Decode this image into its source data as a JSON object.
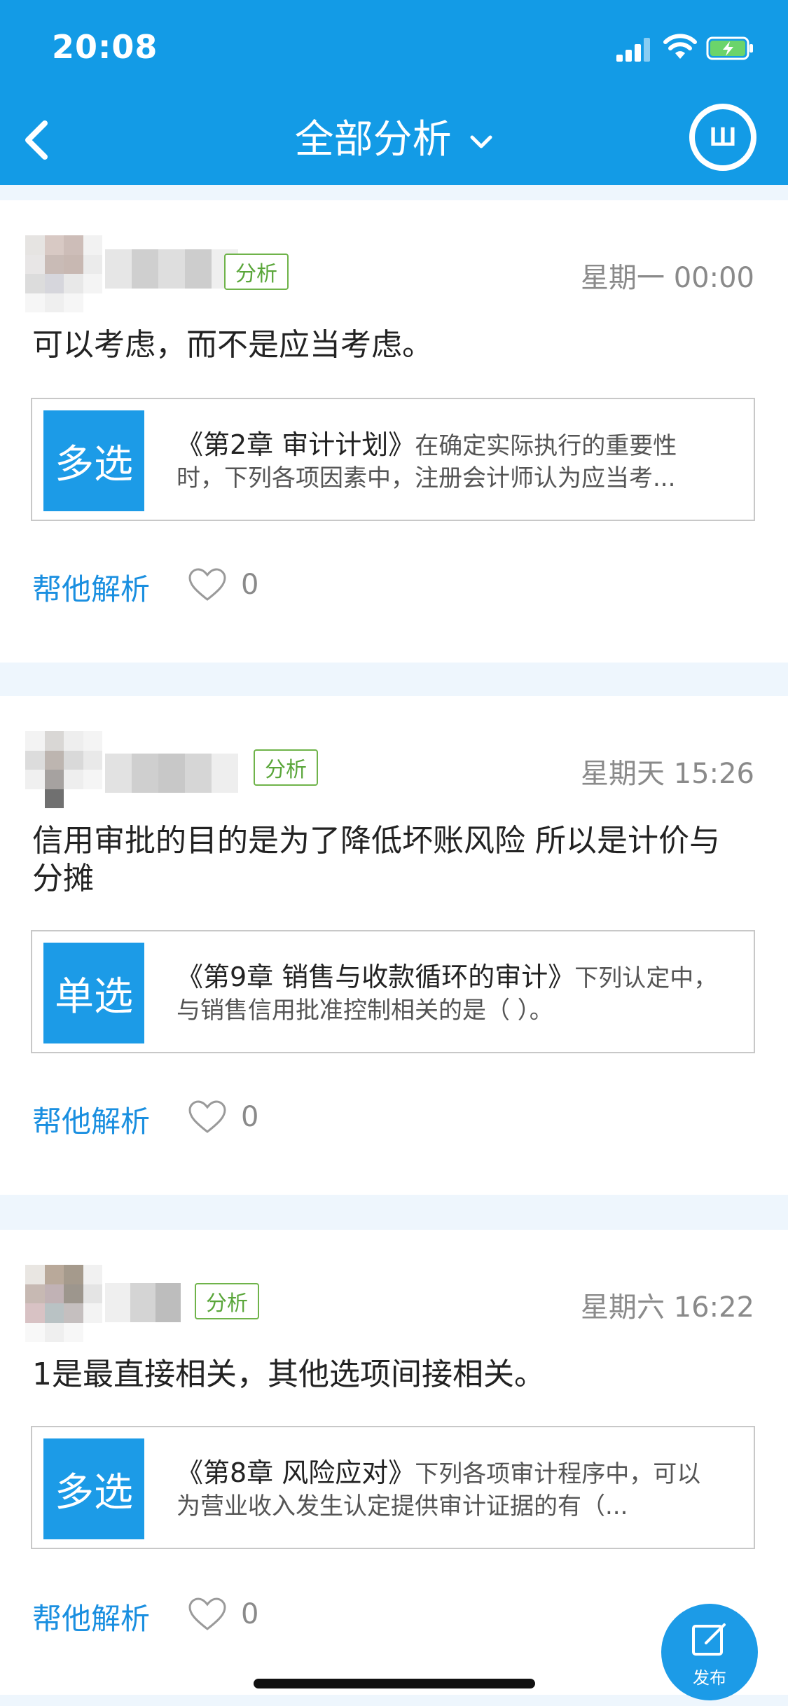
{
  "status_bar": {
    "time": "20:08"
  },
  "nav": {
    "title": "全部分析"
  },
  "logo": {
    "text": "Ш"
  },
  "posts": [
    {
      "tag": "分析",
      "time": "星期一 00:00",
      "content": "可以考虑，而不是应当考虑。",
      "question": {
        "type": "多选",
        "chapter": "《第2章  审计计划》",
        "text": "在确定实际执行的重要性时，下列各项因素中，注册会计师认为应当考..."
      },
      "help_label": "帮他解析",
      "likes": "0"
    },
    {
      "tag": "分析",
      "time": "星期天 15:26",
      "content": "信用审批的目的是为了降低坏账风险  所以是计价与分摊",
      "question": {
        "type": "单选",
        "chapter": "《第9章  销售与收款循环的审计》",
        "text": "下列认定中，与销售信用批准控制相关的是（ ）。"
      },
      "help_label": "帮他解析",
      "likes": "0"
    },
    {
      "tag": "分析",
      "time": "星期六 16:22",
      "content": "1是最直接相关，其他选项间接相关。",
      "question": {
        "type": "多选",
        "chapter": "《第8章    风险应对》",
        "text": "下列各项审计程序中，可以为营业收入发生认定提供审计证据的有（..."
      },
      "help_label": "帮他解析",
      "likes": "0"
    }
  ],
  "fab": {
    "label": "发布"
  },
  "colors": {
    "primary": "#139be6",
    "tag_green": "#5aa63a",
    "link_blue": "#1a8fe0"
  }
}
